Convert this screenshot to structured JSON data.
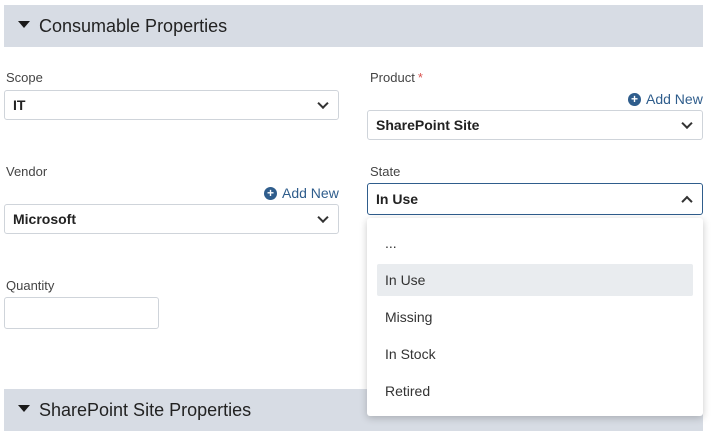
{
  "sections": {
    "consumable": {
      "title": "Consumable Properties"
    },
    "sharepoint": {
      "title": "SharePoint Site Properties"
    }
  },
  "fields": {
    "scope": {
      "label": "Scope",
      "value": "IT"
    },
    "product": {
      "label": "Product",
      "required_mark": "*",
      "value": "SharePoint Site",
      "add_new": "Add New"
    },
    "vendor": {
      "label": "Vendor",
      "value": "Microsoft",
      "add_new": "Add New"
    },
    "state": {
      "label": "State",
      "value": "In Use"
    },
    "quantity": {
      "label": "Quantity",
      "value": ""
    }
  },
  "state_dropdown": {
    "options": [
      "...",
      "In Use",
      "Missing",
      "In Stock",
      "Retired"
    ],
    "selected": "In Use"
  },
  "colors": {
    "section_bg": "#d7dce4",
    "link": "#2f5d8c",
    "required": "#d9534f",
    "focus_border": "#2f5d8c"
  }
}
